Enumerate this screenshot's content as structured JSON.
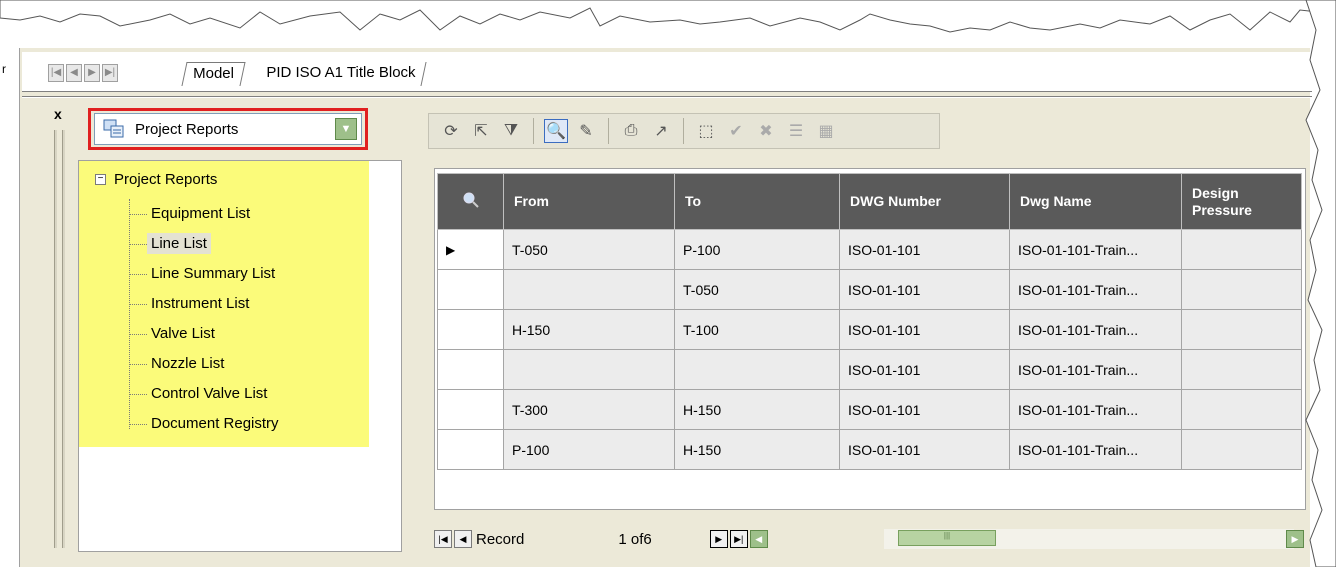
{
  "layout_tabs": {
    "model": "Model",
    "pid": "PID ISO A1 Title Block"
  },
  "left_strip_letter": "r",
  "palette": {
    "close_label": "x",
    "selector_value": "Project Reports",
    "tree": {
      "root": "Project Reports",
      "items": [
        {
          "label": "Equipment List"
        },
        {
          "label": "Line List"
        },
        {
          "label": "Line Summary List"
        },
        {
          "label": "Instrument List"
        },
        {
          "label": "Valve List"
        },
        {
          "label": "Nozzle List"
        },
        {
          "label": "Control Valve List"
        },
        {
          "label": "Document Registry"
        }
      ]
    }
  },
  "toolbar_icons": [
    "refresh-icon",
    "export-icon",
    "filter-icon",
    "zoom-icon",
    "edit-icon",
    "print-icon",
    "export-excel-icon",
    "select-icon",
    "accept-icon",
    "reject-icon",
    "edit-rows-icon",
    "columns-icon"
  ],
  "grid": {
    "headers": [
      "From",
      "To",
      "DWG Number",
      "Dwg Name",
      "Design Pressure"
    ],
    "rows": [
      [
        "T-050",
        "P-100",
        "ISO-01-101",
        "ISO-01-101-Train...",
        ""
      ],
      [
        "",
        "T-050",
        "ISO-01-101",
        "ISO-01-101-Train...",
        ""
      ],
      [
        "H-150",
        "T-100",
        "ISO-01-101",
        "ISO-01-101-Train...",
        ""
      ],
      [
        "",
        "",
        "ISO-01-101",
        "ISO-01-101-Train...",
        ""
      ],
      [
        "T-300",
        "H-150",
        "ISO-01-101",
        "ISO-01-101-Train...",
        ""
      ],
      [
        "P-100",
        "H-150",
        "ISO-01-101",
        "ISO-01-101-Train...",
        ""
      ]
    ]
  },
  "record_nav": {
    "label": "Record",
    "position": "1 of6"
  },
  "colors": {
    "highlight": "#e02020",
    "tree_bg": "#fbfb7a",
    "header_bg": "#5a5a5a"
  }
}
